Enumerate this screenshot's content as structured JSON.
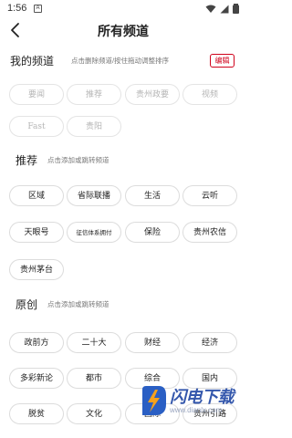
{
  "status": {
    "time": "1:56",
    "app_icon": "A"
  },
  "header": {
    "title": "所有频道"
  },
  "mine": {
    "heading": "我的频道",
    "hint": "点击删除频道/按住拖动调整排序",
    "edit_label": "编辑",
    "items": [
      "要闻",
      "推荐",
      "贵州政要",
      "视频",
      "Fast",
      "贵阳"
    ]
  },
  "recommend": {
    "heading": "推荐",
    "hint": "点击添加或跳转频道",
    "items": [
      "区域",
      "省际联播",
      "生活",
      "云听",
      "天眼号",
      "征信体系拥付",
      "保险",
      "贵州农信",
      "贵州茅台"
    ]
  },
  "original": {
    "heading": "原创",
    "hint": "点击添加或跳转频道",
    "items": [
      "政前方",
      "二十大",
      "财经",
      "经济",
      "多彩新论",
      "都市",
      "综合",
      "国内",
      "脱贫",
      "文化",
      "国际",
      "贵州引路"
    ]
  },
  "watermark": {
    "name": "闪电下载",
    "url": "www.dianlx.com"
  },
  "colors": {
    "accent": "#d0021b"
  }
}
